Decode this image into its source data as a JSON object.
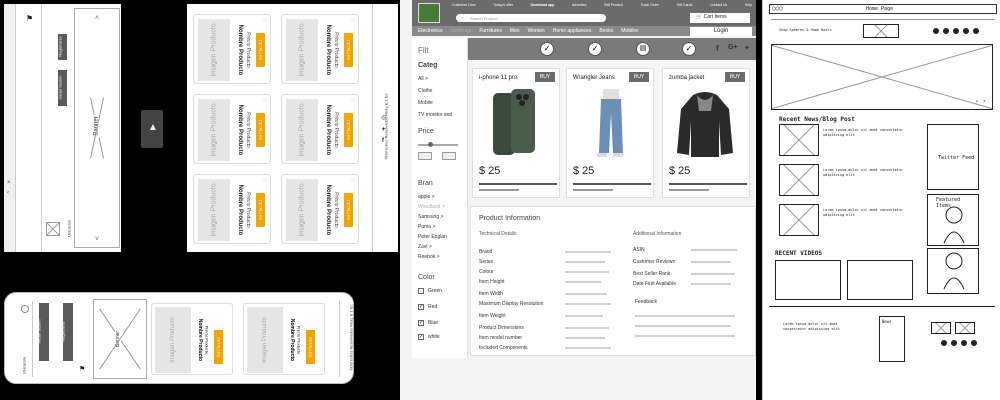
{
  "panel1": {
    "sidebar_buttons": [
      "Registrarse",
      "Iniciar Sesion"
    ],
    "banner_label": "Banner",
    "bottom_text": "Ubicacion",
    "footer_text": "©Derechos Reservados Filuq.  E 1 Ec",
    "products": [
      {
        "image": "Imagen Producto",
        "name": "Nombre Producto",
        "price": "Precio Producto",
        "button": "DETALLES"
      },
      {
        "image": "Imagen Producto",
        "name": "Nombre Producto",
        "price": "Precio Producto",
        "button": "DETALLES"
      },
      {
        "image": "Imagen Producto",
        "name": "Nombre Producto",
        "price": "Precio Producto",
        "button": "DETALLES"
      },
      {
        "image": "Imagen Producto",
        "name": "Nombre Producto",
        "price": "Precio Producto",
        "button": "DETALLES"
      },
      {
        "image": "Imagen Producto",
        "name": "Nombre Producto",
        "price": "Precio Producto",
        "button": "DETALLES"
      },
      {
        "image": "Imagen Producto",
        "name": "Nombre Producto",
        "price": "Precio Producto",
        "button": "DETALLES"
      }
    ]
  },
  "panel2": {
    "sidebar_buttons": [
      "Iniciar Sesion",
      "Registrarse"
    ],
    "banner_label": "Banner",
    "bottom_text": "Ubicacion",
    "footer_text": "©Derechos Reservados Filuq.  E 1 Ec",
    "products": [
      {
        "image": "Imagen Producto",
        "name": "Nombre Producto",
        "price": "Precio Producto",
        "button": "DETALLES"
      },
      {
        "image": "Imagen Producto",
        "name": "Nombre Producto",
        "price": "Precio Producto",
        "button": "DETALLES"
      }
    ]
  },
  "panel3": {
    "top_links": [
      "Customer Care",
      "Today's offer",
      "Download app",
      "Advertise",
      "Sell Product",
      "Track Order",
      "Gift Cards",
      "Contact Us",
      "Help"
    ],
    "search_placeholder": "Search Product",
    "cart_label": "Cart Items",
    "login_label": "Login",
    "categories": [
      "Electronics",
      "Clothings",
      "Furnitures",
      "Men",
      "Women",
      "Home appliances",
      "Books",
      "Mobiles"
    ],
    "filter_title": "Filt",
    "categ_title": "Categ",
    "categ_items": [
      "All >",
      "Clothe",
      "Mobile",
      "TV monitor and"
    ],
    "price_title": "Price",
    "brand_title": "Bran",
    "brands": [
      "apple >",
      "Woodland >",
      "Samsung >",
      "Puma >",
      "Peter Englan",
      "Zavi >",
      "Reebok >"
    ],
    "color_title": "Color",
    "colors": [
      {
        "name": "Green",
        "checked": false
      },
      {
        "name": "Red",
        "checked": true
      },
      {
        "name": "Blue",
        "checked": true
      },
      {
        "name": "white",
        "checked": true
      }
    ],
    "buy_label": "BUY",
    "products": [
      {
        "name": "i-phone 11 pro",
        "price": "$ 25"
      },
      {
        "name": "Wrangler Jeans",
        "price": "$ 25"
      },
      {
        "name": "zumba jacket",
        "price": "$ 25"
      }
    ],
    "info_title": "Product Information",
    "tech_title": "Technical Details",
    "tech_rows": [
      "Brand",
      "Series",
      "Colour",
      "Item Height",
      "Item Width",
      "Maximum Display Resolution",
      "Item Weight",
      "Product Dimensions",
      "Item model number",
      "Included Components"
    ],
    "add_title": "Additional Information",
    "add_rows": [
      "ASIN",
      "Customer Reviews",
      "Best Seller Rank",
      "Date First Available"
    ],
    "feedback_title": "Feedback"
  },
  "panel4": {
    "browser_title": "Home Page",
    "tiny_header": "Shop Spheres & Home Deals",
    "blog_title": "Recent News/Blog Post",
    "blog_text": "Lorem ipsum dolor sit amet consectetur adipiscing elit",
    "twitter_title": "Twitter Feed",
    "featured_title": "Featured Items",
    "video_title": "RECENT VIDEOS",
    "news_label": "News"
  }
}
